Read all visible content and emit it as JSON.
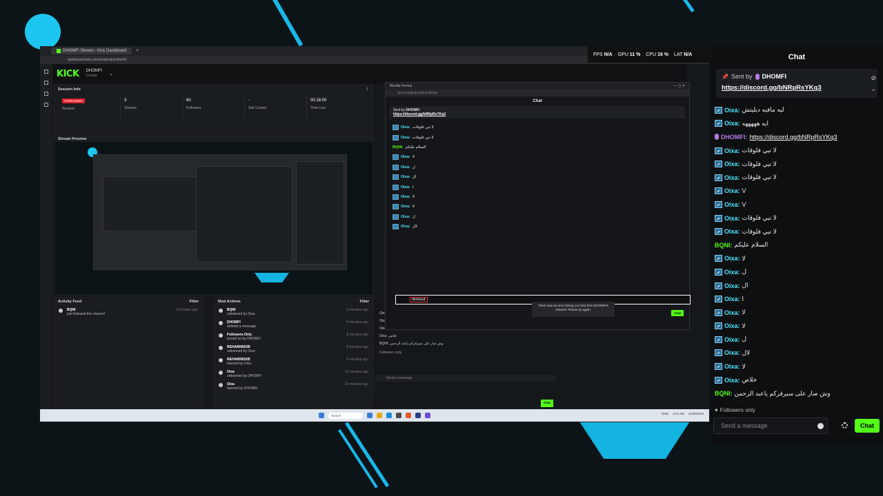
{
  "browser": {
    "tab_title": "DHOMFI Stream - Kick Dashboard",
    "url": "dashboard.kick.com/moderator/dhomfi",
    "perf": {
      "fps_label": "FPS",
      "fps": "N/A",
      "gpu_label": "GPU",
      "gpu": "11 %",
      "cpu_label": "CPU",
      "cpu": "16 %",
      "lat_label": "LAT",
      "lat": "N/A"
    }
  },
  "header": {
    "logo": "KICK",
    "channel": "DHOMFI",
    "role": "Creator"
  },
  "session": {
    "title": "Session Info",
    "status": "STREAMING",
    "session_label": "Session",
    "viewers": "3",
    "viewers_label": "Viewers",
    "followers": "60",
    "followers_label": "Followers",
    "subs": "-",
    "subs_label": "Sub Counts",
    "time": "00:18:00",
    "time_label": "Time Live"
  },
  "preview": {
    "title": "Stream Preview"
  },
  "activity": {
    "title": "Activity Feed",
    "filter": "Filter",
    "items": [
      {
        "user": "BQNI",
        "action": "just followed the channel",
        "time": "9 minutes ago"
      }
    ]
  },
  "mod": {
    "title": "Mod Actions",
    "filter": "Filter",
    "items": [
      {
        "user": "BQNI",
        "action": "unbanned by Oixa",
        "time": "5 minutes ago"
      },
      {
        "user": "DHOMFI",
        "action": "deleted a message",
        "time": "5 minutes ago"
      },
      {
        "user": "Followers-Only",
        "action": "turned on by DHOMFI",
        "time": "8 minutes ago"
      },
      {
        "user": "REHAMNISXB",
        "action": "unbanned by Oixa",
        "time": "8 minutes ago"
      },
      {
        "user": "REHAMNISXB",
        "action": "banned by Oixa",
        "time": "8 minutes ago"
      },
      {
        "user": "Oixa",
        "action": "unbanned by DHOMFI",
        "time": "10 minutes ago"
      },
      {
        "user": "Oixa",
        "action": "banned by DHOMFI",
        "time": "10 minutes ago"
      }
    ]
  },
  "popout": {
    "window_title": "Mozilla Firefox",
    "url": "kick.com/popout/dhomfi/chat",
    "chat_title": "Chat",
    "pinned_by": "Sent by",
    "pinned_sender": "DHOMFI",
    "pinned_link": "https://discord.gg/bNRpRsYKq3",
    "messages": [
      {
        "user": "Oixa:",
        "text": "لا تبي فلوقات"
      },
      {
        "user": "Oixa:",
        "text": "لا تبي فلوقات"
      },
      {
        "user": "BQNI:",
        "text": "السلام عليكم"
      },
      {
        "user": "Oixa:",
        "text": "لا"
      },
      {
        "user": "Oixa:",
        "text": "ل"
      },
      {
        "user": "Oixa:",
        "text": "ال"
      },
      {
        "user": "Oixa:",
        "text": "ا"
      },
      {
        "user": "Oixa:",
        "text": "لا"
      },
      {
        "user": "Oixa:",
        "text": "لا"
      },
      {
        "user": "Oixa:",
        "text": "ل"
      },
      {
        "user": "Oixa:",
        "text": "لال"
      }
    ],
    "input_value": "/timeout",
    "error": "There was an error timing out Oixa from DHOMFI's channel. Please try again.",
    "chat_button": "Chat"
  },
  "bgchat": {
    "lines": [
      "Oixa: ل",
      "Oixa: لال",
      "Oixa: ا",
      "Oixa: خلاص",
      "BQNI: وش صار على سيرفركم ياعبد الرحمن"
    ],
    "followers_only": "Followers only",
    "placeholder": "Send a message",
    "chat_button": "Chat"
  },
  "taskbar": {
    "search": "Search",
    "lang": "ENG",
    "time": "2:21 AM",
    "date": "11/26/2024"
  },
  "chat": {
    "title": "Chat",
    "pinned": {
      "sent_by": "Sent by",
      "sender": "DHOMFI",
      "link": "https://discord.gg/bNRpRsYKq3"
    },
    "messages": [
      {
        "user": "Oixa:",
        "text": "ليه مافيه دبليتش"
      },
      {
        "user": "Oixa:",
        "text": "ايه هههههه"
      },
      {
        "user": "DHOMFI:",
        "text": "https://discord.gg/bNRpRsYKq3",
        "is_link": true,
        "color": "#b57be0"
      },
      {
        "user": "Oixa:",
        "text": "لا تبي فلوقات"
      },
      {
        "user": "Oixa:",
        "text": "لا تبي فلوقات"
      },
      {
        "user": "Oixa:",
        "text": "لا تبي فلوقات"
      },
      {
        "user": "Oixa:",
        "text": "V"
      },
      {
        "user": "Oixa:",
        "text": "V"
      },
      {
        "user": "Oixa:",
        "text": "لا تبي فلوقات"
      },
      {
        "user": "Oixa:",
        "text": "لا تبي فلوقات"
      },
      {
        "user": "BQNI:",
        "text": "السلام عليكم",
        "color": "#53fc18"
      },
      {
        "user": "Oixa:",
        "text": "لا"
      },
      {
        "user": "Oixa:",
        "text": "ل"
      },
      {
        "user": "Oixa:",
        "text": "ال"
      },
      {
        "user": "Oixa:",
        "text": "ا"
      },
      {
        "user": "Oixa:",
        "text": "لا"
      },
      {
        "user": "Oixa:",
        "text": "لا"
      },
      {
        "user": "Oixa:",
        "text": "ل"
      },
      {
        "user": "Oixa:",
        "text": "لال"
      },
      {
        "user": "Oixa:",
        "text": "لا"
      },
      {
        "user": "Oixa:",
        "text": "خلاص"
      },
      {
        "user": "BQNI:",
        "text": "وش صار على سيرفركم ياعبد الرحمن",
        "color": "#53fc18"
      }
    ],
    "followers_only": "Followers only",
    "input_placeholder": "Send a message",
    "chat_button": "Chat",
    "user_color": "#4fe8ff"
  },
  "colors": {
    "accent": "#53fc18",
    "stripe": "#18b8e8",
    "panel": "#1a1d20"
  }
}
